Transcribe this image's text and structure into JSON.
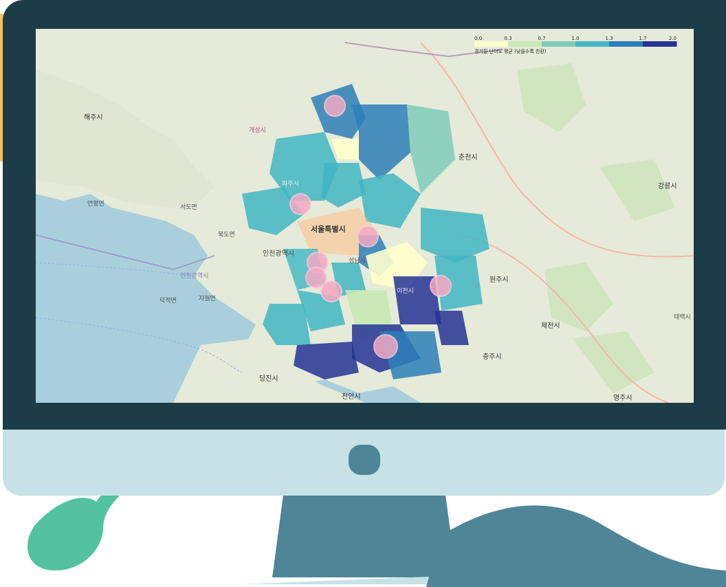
{
  "legend": {
    "title": "경기질 난이도 평균 (낮을수록 친환)",
    "ticks": [
      "0.0",
      "0.3",
      "0.7",
      "1.0",
      "1.3",
      "1.7",
      "2.0"
    ],
    "colors": [
      "#ffffcc",
      "#c7e9b4",
      "#7fcdbb",
      "#41b6c4",
      "#2c7fb8",
      "#253494"
    ]
  },
  "map_labels": {
    "seoul": "서울특별시",
    "incheon": "인천광역시",
    "incheon_sea": "인천광역시",
    "chuncheon": "춘천시",
    "wonju": "원주시",
    "jecheon": "제천시",
    "chungju": "충주시",
    "gangneung": "강릉시",
    "yeongju": "영주시",
    "cheonan": "천안시",
    "dangjin": "당진시",
    "haeju": "해주시",
    "gaeseong": "개성시",
    "icheon": "이천시",
    "seongnam": "성남시",
    "paju": "파주시",
    "yeonpyeong": "연평면",
    "deokjeok": "덕적면",
    "jaweol": "자월면",
    "seodo": "서도면",
    "bukdo": "북도면",
    "taebaek": "태백시"
  },
  "colors": {
    "frame": "#1c3c48",
    "chin": "#c6e2e6",
    "accent_teal": "#4f8697",
    "accent_green": "#52c29f",
    "accent_yellow": "#f6c25b",
    "marker": "#f4a9c4"
  }
}
